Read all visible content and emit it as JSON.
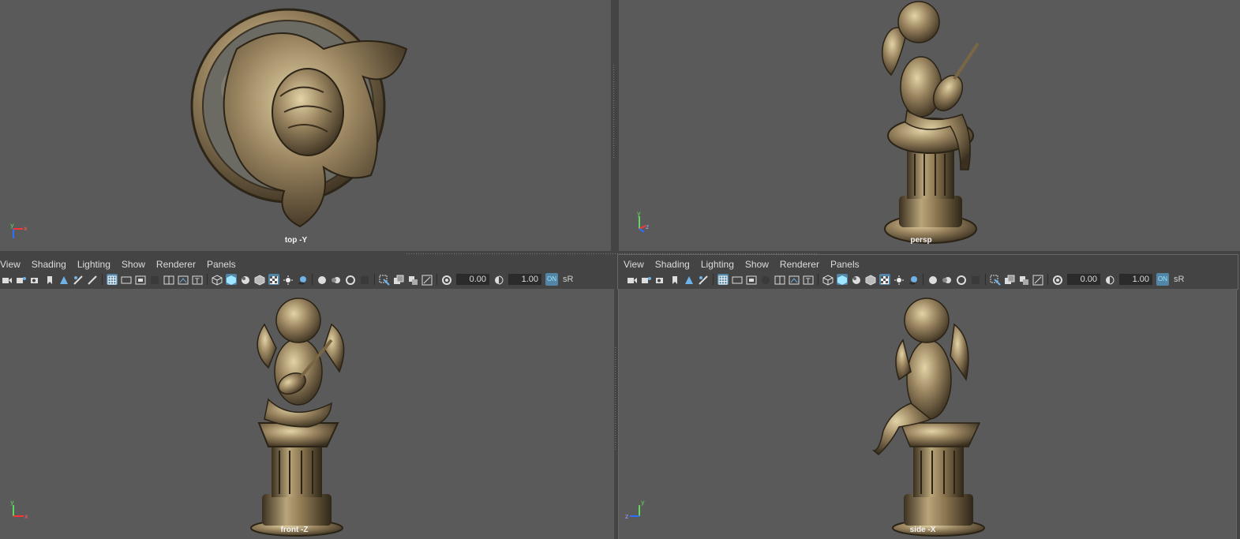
{
  "viewports": {
    "top": {
      "label": "top -Y"
    },
    "persp": {
      "label": "persp"
    },
    "front": {
      "label": "front -Z"
    },
    "side": {
      "label": "side -X"
    }
  },
  "panel_menu_left": [
    "View",
    "Shading",
    "Lighting",
    "Show",
    "Renderer",
    "Panels"
  ],
  "panel_menu_right": [
    "View",
    "Shading",
    "Lighting",
    "Show",
    "Renderer",
    "Panels"
  ],
  "toolbar_left": {
    "exposure": "0.00",
    "gamma": "1.00",
    "color_mgmt": "ON",
    "color_space": "sR"
  },
  "toolbar_right": {
    "exposure": "0.00",
    "gamma": "1.00",
    "color_mgmt": "ON",
    "color_space": "sR"
  },
  "axis_labels": {
    "x": "x",
    "y": "y",
    "z": "z"
  },
  "colors": {
    "viewport_bg": "#5a5a5a",
    "ui_bg": "#444444",
    "active_icon": "#5285a6",
    "bronze": "#9a8560"
  }
}
